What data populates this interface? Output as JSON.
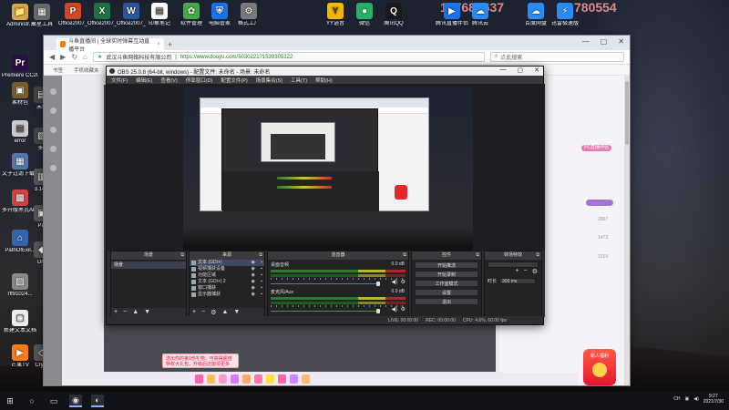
{
  "desktop": {
    "icons_left": [
      {
        "label": "Administr...",
        "glyph": "📁",
        "color": "#d9a64a"
      },
      {
        "label": "Premiere CC2019",
        "glyph": "Pr",
        "color": "#2a0f44"
      },
      {
        "label": "素材包",
        "glyph": "▣",
        "color": "#7a5c2a"
      },
      {
        "label": "error",
        "glyph": "▤",
        "color": "#cccccc"
      },
      {
        "label": "文子过滤下载地址",
        "glyph": "▦",
        "color": "#5577aa"
      },
      {
        "label": "多开版黑瓦AHK20.19...",
        "glyph": "▩",
        "color": "#cc4444"
      },
      {
        "label": "PathOfExil...",
        "glyph": "⌂",
        "color": "#3366aa"
      },
      {
        "label": "rff91024...",
        "glyph": "▨",
        "color": "#888888"
      },
      {
        "label": "新建文本文档",
        "glyph": "▢",
        "color": "#eeeeee"
      },
      {
        "label": "芒果TV",
        "glyph": "▶",
        "color": "#ff7a1a"
      }
    ],
    "icons_col2": [
      {
        "label": "聚星工具",
        "glyph": "▦",
        "color": "#6a6a6a"
      },
      {
        "label": "未命",
        "glyph": "▤",
        "color": "#444444"
      },
      {
        "label": "多7",
        "glyph": "▧",
        "color": "#444444"
      },
      {
        "label": "3.14.0",
        "glyph": "▥",
        "color": "#555555"
      },
      {
        "label": "Pat",
        "glyph": "▣",
        "color": "#555555"
      },
      {
        "label": "Divi",
        "glyph": "◆",
        "color": "#555555"
      },
      {
        "label": "Crysti",
        "glyph": "◇",
        "color": "#555555"
      }
    ],
    "icons_top": [
      {
        "label": "Office2007_",
        "glyph": "P",
        "color": "#d24726"
      },
      {
        "label": "Office2007_",
        "glyph": "X",
        "color": "#1f7244"
      },
      {
        "label": "Office2007_",
        "glyph": "W",
        "color": "#2b579a"
      },
      {
        "label": "印象笔记",
        "glyph": "▤",
        "color": "#ffffff"
      },
      {
        "label": "软件管理",
        "glyph": "✿",
        "color": "#44aa44"
      },
      {
        "label": "电脑管家",
        "glyph": "⛨",
        "color": "#1a73e8"
      },
      {
        "label": "格式工厂",
        "glyph": "⚙",
        "color": "#7a7a7a"
      },
      {
        "label": "YY语音",
        "glyph": "Y",
        "color": "#f2b600"
      },
      {
        "label": "微信",
        "glyph": "●",
        "color": "#2aae67"
      },
      {
        "label": "腾讯QQ",
        "glyph": "Q",
        "color": "#1a1a1a"
      },
      {
        "label": "腾讯直播伴侣",
        "glyph": "▶",
        "color": "#1a73e8"
      },
      {
        "label": "腾讯云",
        "glyph": "☁",
        "color": "#2a8bf2"
      },
      {
        "label": "百度网盘",
        "glyph": "☁",
        "color": "#2a8bf2"
      },
      {
        "label": "迅雷极速版",
        "glyph": "⚡",
        "color": "#2a8bf2"
      }
    ],
    "overlay_numbers": [
      "177683637",
      "780554"
    ]
  },
  "browser": {
    "tab_title": "斗鱼直播间 | 全球实时弹幕互动直播平台",
    "tab_close": "×",
    "new_tab": "+",
    "window_buttons": [
      "—",
      "▢",
      "✕"
    ],
    "company": "武汉斗鱼网络科技有限公司",
    "url": "https://www.douyu.com/5030221?1539305322",
    "search_placeholder": "点此搜索",
    "bookmarks": [
      "书签",
      "手机收藏夹"
    ],
    "right_text": "PC直播伴侣",
    "rank_numbers": [
      "2907",
      "1473",
      "1019"
    ],
    "toast_lines": [
      "送出你的第1份礼物，可获得超值",
      "特权大礼包，升级后还能领更多"
    ],
    "gift_badge_text": "新人福利"
  },
  "obs": {
    "title": "OBS 25.0.8 (64-bit, windows) - 配置文件: 未命名 - 场景: 未命名",
    "window_buttons": [
      "—",
      "▢",
      "✕"
    ],
    "menu": [
      "文件(F)",
      "编辑(E)",
      "查看(V)",
      "停靠窗口(D)",
      "配置文件(P)",
      "场景集合(S)",
      "工具(T)",
      "帮助(H)"
    ],
    "docks": {
      "scenes_title": "场景",
      "sources_title": "来源",
      "mixer_title": "混音器",
      "controls_title": "控件",
      "transitions_title": "转场特效"
    },
    "scenes": [
      "场景"
    ],
    "sources": [
      {
        "name": "文本 (GDI+)",
        "selected": true
      },
      {
        "name": "视频捕获设备",
        "selected": false
      },
      {
        "name": "功能区域",
        "selected": false
      },
      {
        "name": "文本 (GDI+) 2",
        "selected": false
      },
      {
        "name": "窗口捕获",
        "selected": false
      },
      {
        "name": "显示器捕获",
        "selected": false
      }
    ],
    "mixer": [
      {
        "name": "桌面音频",
        "db": "0.0 dB"
      },
      {
        "name": "麦克风/Aux",
        "db": "0.0 dB"
      }
    ],
    "controls": [
      "开始推流",
      "开始录制",
      "工作室模式",
      "设置",
      "退出"
    ],
    "transition": {
      "duration_label": "时长",
      "duration_value": "300 ms"
    },
    "status": {
      "live": "LIVE: 00:00:00",
      "rec": "REC: 00:00:00",
      "cpu": "CPU: 4.6%, 60.00 fps"
    },
    "dock_foot_icons": [
      "+",
      "−",
      "▲",
      "▼"
    ],
    "source_foot_icons": [
      "+",
      "−",
      "⚙",
      "▲",
      "▼"
    ]
  },
  "taskbar": {
    "start": "⊞",
    "items": [
      "○",
      "▭",
      "◉",
      "◐"
    ],
    "clock_time": "9:27",
    "clock_date": "2021/7/30",
    "tray_lang": "CH"
  }
}
